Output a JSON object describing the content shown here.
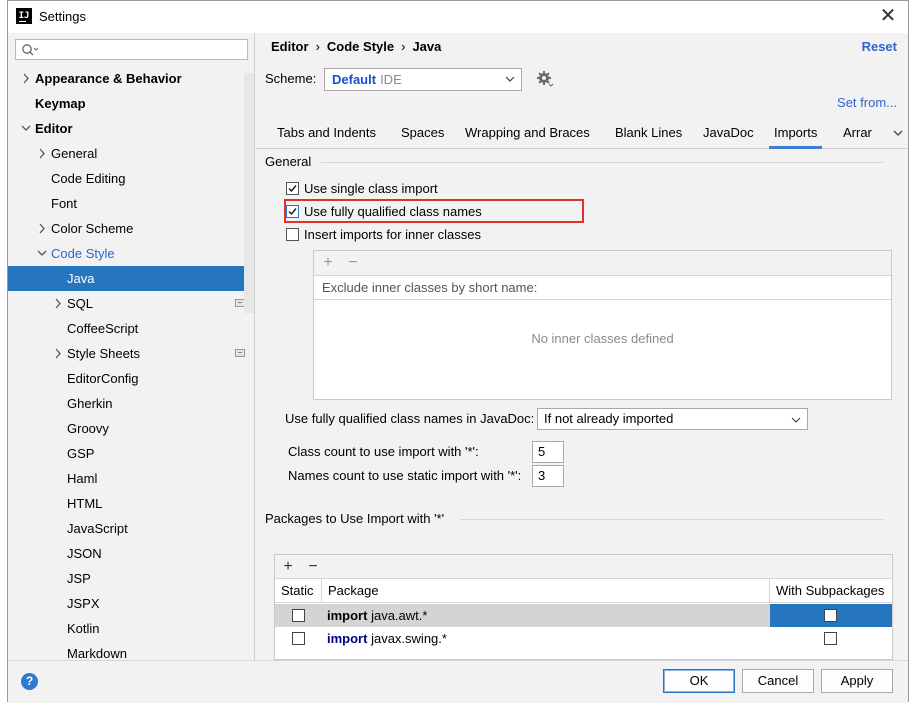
{
  "window": {
    "title": "Settings",
    "app_icon": "IJ"
  },
  "sidebar": {
    "search_placeholder": "",
    "items": [
      {
        "label": "Appearance & Behavior",
        "has_arrow": true,
        "expanded": false,
        "bold": true
      },
      {
        "label": "Keymap",
        "has_arrow": false,
        "bold": true
      },
      {
        "label": "Editor",
        "has_arrow": true,
        "expanded": true,
        "bold": true
      },
      {
        "label": "General",
        "has_arrow": true,
        "expanded": false
      },
      {
        "label": "Code Editing",
        "has_arrow": false
      },
      {
        "label": "Font",
        "has_arrow": false
      },
      {
        "label": "Color Scheme",
        "has_arrow": true,
        "expanded": false
      },
      {
        "label": "Code Style",
        "has_arrow": true,
        "expanded": true,
        "color": "#2f65ca"
      },
      {
        "label": "Java",
        "selected": true
      },
      {
        "label": "SQL",
        "has_arrow": true,
        "project_icon": true
      },
      {
        "label": "CoffeeScript"
      },
      {
        "label": "Style Sheets",
        "has_arrow": true,
        "project_icon": true
      },
      {
        "label": "EditorConfig"
      },
      {
        "label": "Gherkin"
      },
      {
        "label": "Groovy"
      },
      {
        "label": "GSP"
      },
      {
        "label": "Haml"
      },
      {
        "label": "HTML"
      },
      {
        "label": "JavaScript"
      },
      {
        "label": "JSON"
      },
      {
        "label": "JSP"
      },
      {
        "label": "JSPX"
      },
      {
        "label": "Kotlin"
      },
      {
        "label": "Markdown"
      }
    ]
  },
  "header": {
    "breadcrumb": [
      "Editor",
      "Code Style",
      "Java"
    ],
    "reset_label": "Reset",
    "scheme_label": "Scheme:",
    "scheme_value": "Default",
    "scheme_sub": "IDE",
    "set_from_label": "Set from..."
  },
  "tabs": [
    "Tabs and Indents",
    "Spaces",
    "Wrapping and Braces",
    "Blank Lines",
    "JavaDoc",
    "Imports",
    "Arrar"
  ],
  "active_tab": "Imports",
  "general": {
    "title": "General",
    "use_single_class_import": {
      "label": "Use single class import",
      "checked": true
    },
    "use_fully_qualified": {
      "label": "Use fully qualified class names",
      "checked": true
    },
    "insert_imports_inner": {
      "label": "Insert imports for inner classes",
      "checked": false
    },
    "inner_table_header": "Exclude inner classes by short name:",
    "inner_table_empty": "No inner classes defined",
    "javadoc_label": "Use fully qualified class names in JavaDoc:",
    "javadoc_value": "If not already imported",
    "class_count_label": "Class count to use import with '*':",
    "class_count_value": "5",
    "names_count_label": "Names count to use static import with '*':",
    "names_count_value": "3"
  },
  "packages": {
    "title": "Packages to Use Import with '*'",
    "columns": [
      "Static",
      "Package",
      "With Subpackages"
    ],
    "rows": [
      {
        "keyword": "import",
        "package": "java.awt.*",
        "static": false,
        "subpackages": false,
        "selected": true
      },
      {
        "keyword": "import",
        "package": "javax.swing.*",
        "static": false,
        "subpackages": false,
        "selected": false
      }
    ]
  },
  "buttons": {
    "ok": "OK",
    "cancel": "Cancel",
    "apply": "Apply",
    "help": "?"
  },
  "colors": {
    "selection": "#2675bf",
    "link": "#2f65ca",
    "highlight_border": "#e0322b",
    "keyword": "#000080"
  }
}
